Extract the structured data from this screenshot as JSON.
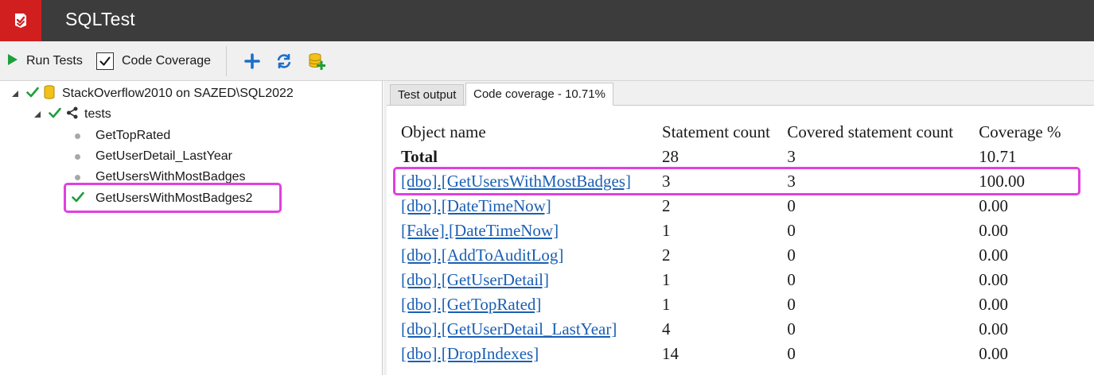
{
  "app": {
    "title": "SQLTest"
  },
  "toolbar": {
    "run_tests_label": "Run Tests",
    "code_coverage_label": "Code Coverage",
    "code_coverage_checked": true
  },
  "icons": {
    "logo": "sqltest-logo-icon",
    "run": "play-icon",
    "add": "plus-icon",
    "refresh": "refresh-icon",
    "database_add": "database-add-icon"
  },
  "colors": {
    "titlebar": "#3c3c3c",
    "brand_red": "#d11f1f",
    "pass_green": "#1e9e3c",
    "link_blue": "#1a5fb4",
    "highlight_magenta": "#e040e0"
  },
  "tree": {
    "database": {
      "label": "StackOverflow2010 on SAZED\\SQL2022",
      "status": "pass",
      "expanded": true
    },
    "schema": {
      "label": "tests",
      "status": "pass",
      "expanded": true
    },
    "tests": [
      {
        "label": "GetTopRated",
        "status": "not-run"
      },
      {
        "label": "GetUserDetail_LastYear",
        "status": "not-run"
      },
      {
        "label": "GetUsersWithMostBadges",
        "status": "not-run"
      },
      {
        "label": "GetUsersWithMostBadges2",
        "status": "pass",
        "highlighted": true
      }
    ]
  },
  "tabs": [
    {
      "label": "Test output",
      "active": false
    },
    {
      "label": "Code coverage - 10.71%",
      "active": true
    }
  ],
  "coverage": {
    "headers": [
      "Object name",
      "Statement count",
      "Covered statement count",
      "Coverage %"
    ],
    "total": {
      "label": "Total",
      "statements": "28",
      "covered": "3",
      "coverage": "10.71"
    },
    "rows": [
      {
        "name": "[dbo].[GetUsersWithMostBadges]",
        "statements": "3",
        "covered": "3",
        "coverage": "100.00",
        "highlighted": true
      },
      {
        "name": "[dbo].[DateTimeNow]",
        "statements": "2",
        "covered": "0",
        "coverage": "0.00"
      },
      {
        "name": "[Fake].[DateTimeNow]",
        "statements": "1",
        "covered": "0",
        "coverage": "0.00"
      },
      {
        "name": "[dbo].[AddToAuditLog]",
        "statements": "2",
        "covered": "0",
        "coverage": "0.00"
      },
      {
        "name": "[dbo].[GetUserDetail]",
        "statements": "1",
        "covered": "0",
        "coverage": "0.00"
      },
      {
        "name": "[dbo].[GetTopRated]",
        "statements": "1",
        "covered": "0",
        "coverage": "0.00"
      },
      {
        "name": "[dbo].[GetUserDetail_LastYear]",
        "statements": "4",
        "covered": "0",
        "coverage": "0.00"
      },
      {
        "name": "[dbo].[DropIndexes]",
        "statements": "14",
        "covered": "0",
        "coverage": "0.00"
      }
    ]
  }
}
